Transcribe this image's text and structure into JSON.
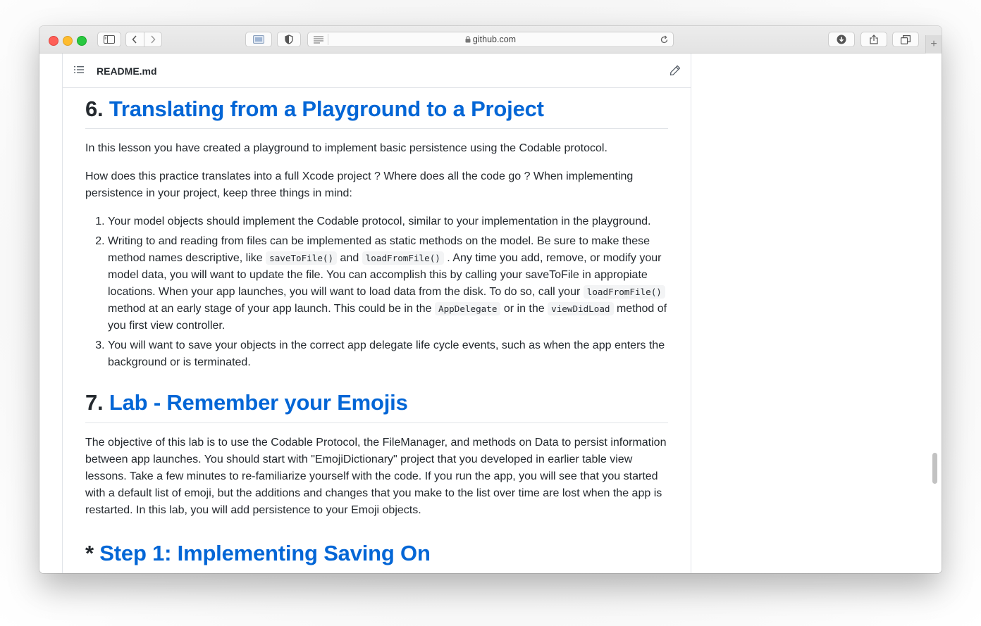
{
  "browser": {
    "url": "github.com",
    "new_tab_symbol": "+"
  },
  "readme": {
    "filename": "README.md"
  },
  "sections": {
    "s6": {
      "number": "6.",
      "title": "Translating from a Playground to a Project",
      "p1": "In this lesson you have created a playground to implement basic persistence using the Codable protocol.",
      "p2": "How does this practice translates into a full Xcode project ? Where does all the code go ? When implementing persistence in your project, keep three things in mind:",
      "li1": "Your model objects should implement the Codable protocol, similar to your implementation in the playground.",
      "li2": {
        "t1": "Writing to and reading from files can be implemented as static methods on the model. Be sure to make these method names descriptive, like ",
        "c1": "saveToFile()",
        "t2": " and ",
        "c2": "loadFromFile()",
        "t3": " . Any time you add, remove, or modify your model data, you will want to update the file. You can accomplish this by calling your saveToFile in appropiate locations. When your app launches, you will want to load data from the disk. To do so, call your ",
        "c3": "loadFromFile()",
        "t4": " method at an early stage of your app launch. This could be in the ",
        "c4": "AppDelegate",
        "t5": " or in the ",
        "c5": "viewDidLoad",
        "t6": " method of you first view controller."
      },
      "li3": "You will want to save your objects in the correct app delegate life cycle events, such as when the app enters the background or is terminated."
    },
    "s7": {
      "number": "7.",
      "title": "Lab - Remember your Emojis",
      "p1": "The objective of this lab is to use the Codable Protocol, the FileManager, and methods on Data to persist information between app launches. You should start with \"EmojiDictionary\" project that you developed in earlier table view lessons. Take a few minutes to re-familiarize yourself with the code. If you run the app, you will see that you started with a default list of emoji, but the additions and changes that you make to the list over time are lost when the app is restarted. In this lab, you will add persistence to your Emoji objects."
    },
    "step1": {
      "prefix": "*",
      "title": "Step 1: Implementing Saving On"
    }
  }
}
